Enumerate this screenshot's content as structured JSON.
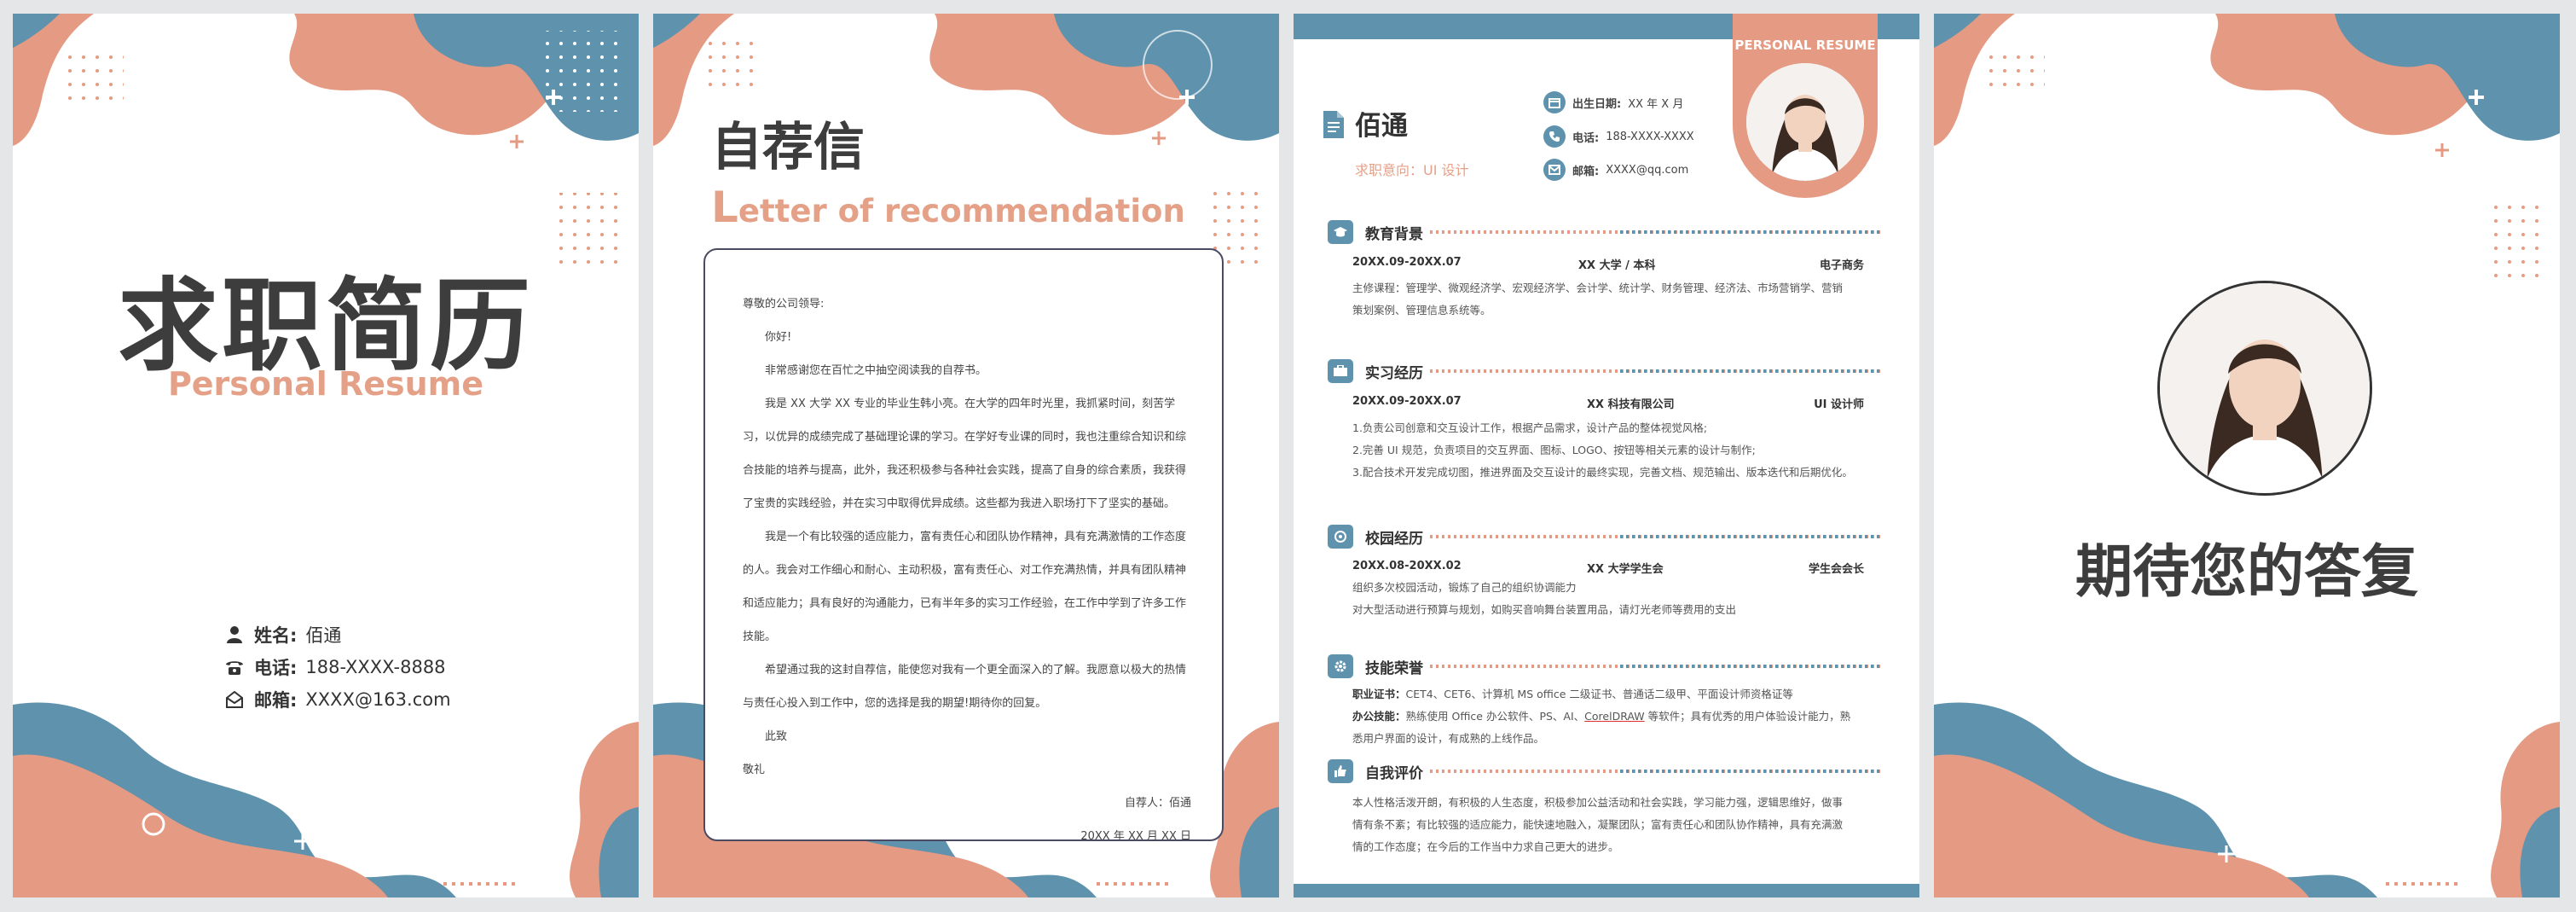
{
  "colors": {
    "pink": "#e59a83",
    "blue": "#5f93ad",
    "dark": "#3d3d3d",
    "accent_text": "#e5a188"
  },
  "cover": {
    "title": "求职简历",
    "subtitle": "Personal Resume",
    "contacts": [
      {
        "icon": "user-icon",
        "label": "姓名:",
        "value": "佰通"
      },
      {
        "icon": "phone-icon",
        "label": "电话:",
        "value": "188-XXXX-8888"
      },
      {
        "icon": "mail-icon",
        "label": "邮箱:",
        "value": "XXXX@163.com"
      }
    ]
  },
  "letter": {
    "title": "自荐信",
    "subtitle_first": "L",
    "subtitle_rest": "etter of recommendation",
    "greeting": "尊敬的公司领导:",
    "salutation": "你好!",
    "paragraphs": [
      "非常感谢您在百忙之中抽空阅读我的自荐书。",
      "我是 XX 大学 XX 专业的毕业生韩小亮。在大学的四年时光里，我抓紧时间，刻苦学习，以优异的成绩完成了基础理论课的学习。在学好专业课的同时，我也注重综合知识和综合技能的培养与提高，此外，我还积极参与各种社会实践，提高了自身的综合素质，我获得了宝贵的实践经验，并在实习中取得优异成绩。这些都为我进入职场打下了坚实的基础。",
      "我是一个有比较强的适应能力，富有责任心和团队协作精神，具有充满激情的工作态度的人。我会对工作细心和耐心、主动积极，富有责任心、对工作充满热情，并具有团队精神和适应能力；具有良好的沟通能力，已有半年多的实习工作经验，在工作中学到了许多工作技能。",
      "希望通过我的这封自荐信，能使您对我有一个更全面深入的了解。我愿意以极大的热情与责任心投入到工作中，您的选择是我的期望!期待你的回复。",
      "此致"
    ],
    "closing": "敬礼",
    "signer": "自荐人：佰通",
    "date": "20XX 年 XX 月 XX 日"
  },
  "resume": {
    "tag": "PERSONAL RESUME",
    "name": "佰通",
    "intent": "求职意向：UI 设计",
    "info": [
      {
        "icon": "calendar-icon",
        "label": "出生日期:",
        "value": "XX 年 X 月"
      },
      {
        "icon": "phone-icon",
        "label": "电话:",
        "value": "188-XXXX-XXXX"
      },
      {
        "icon": "mail-icon",
        "label": "邮箱:",
        "value": "XXXX@qq.com"
      }
    ],
    "education": {
      "heading": "教育背景",
      "period": "20XX.09-20XX.07",
      "org": "XX 大学 / 本科",
      "role": "电子商务",
      "lines": [
        "主修课程：管理学、微观经济学、宏观经济学、会计学、统计学、财务管理、经济法、市场营销学、营销",
        "策划案例、管理信息系统等。"
      ]
    },
    "internship": {
      "heading": "实习经历",
      "period": "20XX.09-20XX.07",
      "org": "XX 科技有限公司",
      "role": "UI 设计师",
      "lines": [
        "1.负责公司创意和交互设计工作，根据产品需求，设计产品的整体视觉风格;",
        "2.完善 UI 规范，负责项目的交互界面、图标、LOGO、按钮等相关元素的设计与制作;",
        "3.配合技术开发完成切图，推进界面及交互设计的最终实现，完善文档、规范输出、版本迭代和后期优化。"
      ]
    },
    "campus": {
      "heading": "校园经历",
      "period": "20XX.08-20XX.02",
      "org": "XX 大学学生会",
      "role": "学生会会长",
      "lines": [
        "组织多次校园活动，锻炼了自己的组织协调能力",
        "对大型活动进行预算与规划，如购买音响舞台装置用品，请灯光老师等费用的支出"
      ]
    },
    "skills": {
      "heading": "技能荣誉",
      "cert_label": "职业证书：",
      "cert": "CET4、CET6、计算机 MS office 二级证书、普通话二级甲、平面设计师资格证等",
      "office_label": "办公技能：",
      "office_a": "熟练使用 Office 办公软件、PS、AI、",
      "office_ul": "CorelDRAW",
      "office_b": " 等软件；具有优秀的用户体验设计能力，熟",
      "office_c": "悉用户界面的设计，有成熟的上线作品。"
    },
    "self": {
      "heading": "自我评价",
      "lines": [
        "本人性格活泼开朗，有积极的人生态度，积极参加公益活动和社会实践，学习能力强，逻辑思维好，做事",
        "情有条不紊；有比较强的适应能力，能快速地融入，凝聚团队；富有责任心和团队协作精神，具有充满激",
        "情的工作态度；在今后的工作当中力求自己更大的进步。"
      ]
    }
  },
  "ending": {
    "title": "期待您的答复"
  }
}
